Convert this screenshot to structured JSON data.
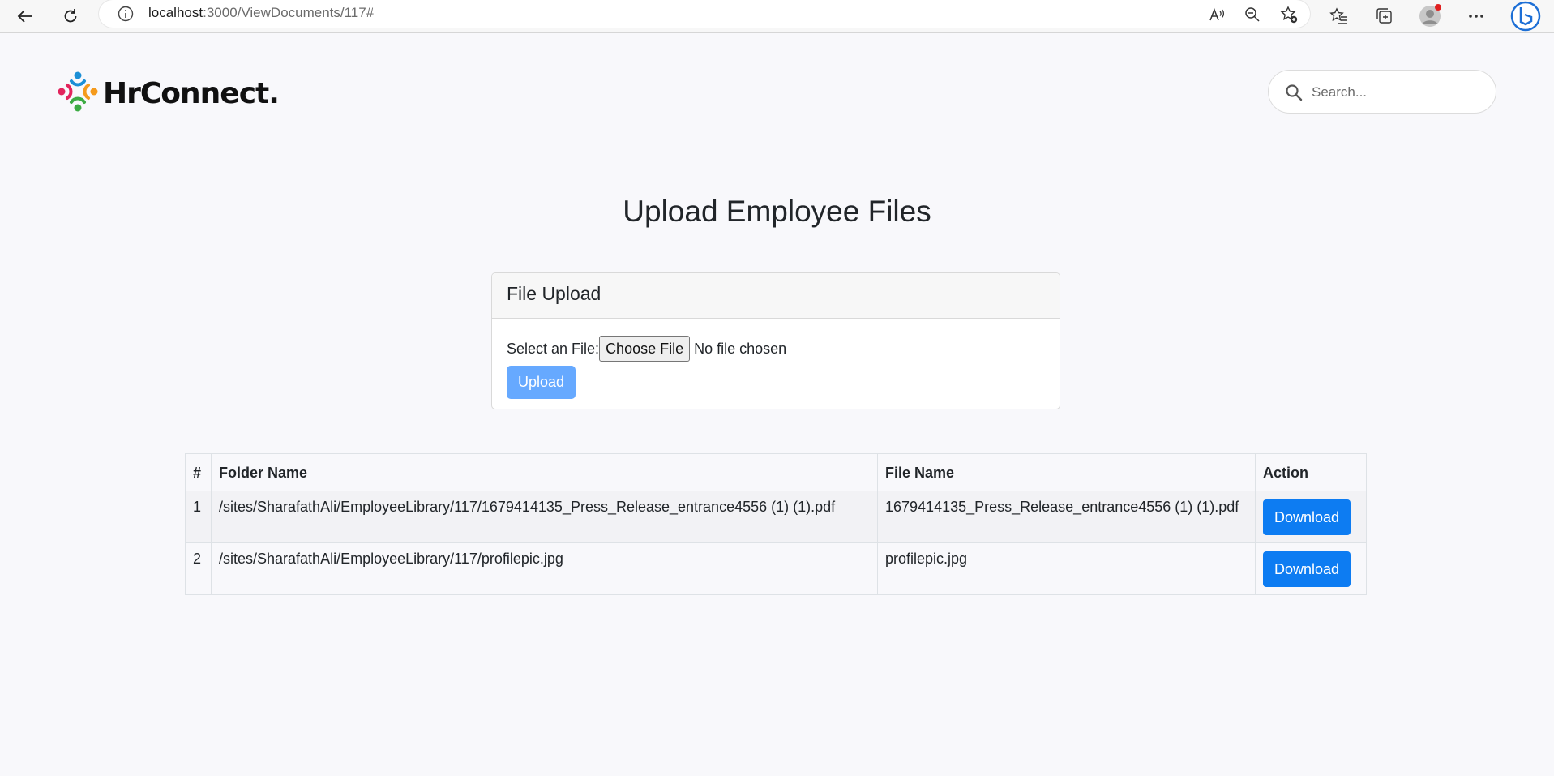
{
  "browser": {
    "url_host": "localhost",
    "url_rest": ":3000/ViewDocuments/117#",
    "icons": [
      "back-icon",
      "refresh-icon",
      "info-icon",
      "read-aloud-icon",
      "zoom-out-icon",
      "add-favorite-icon",
      "favorites-icon",
      "collections-icon",
      "profile-icon",
      "more-icon",
      "bing-icon"
    ]
  },
  "header": {
    "logo_text": "HrConnect.",
    "search_placeholder": "Search..."
  },
  "page_title": "Upload Employee Files",
  "upload_card": {
    "title": "File Upload",
    "select_label": "Select an File:",
    "choose_button": "Choose File",
    "no_file_text": "No file chosen",
    "upload_button": "Upload"
  },
  "table": {
    "headers": [
      "#",
      "Folder Name",
      "File Name",
      "Action"
    ],
    "rows": [
      {
        "num": "1",
        "folder": "/sites/SharafathAli/EmployeeLibrary/117/1679414135_Press_Release_entrance4556 (1) (1).pdf",
        "file": "1679414135_Press_Release_entrance4556 (1) (1).pdf",
        "action": "Download"
      },
      {
        "num": "2",
        "folder": "/sites/SharafathAli/EmployeeLibrary/117/profilepic.jpg",
        "file": "profilepic.jpg",
        "action": "Download"
      }
    ]
  },
  "colors": {
    "primary": "#0d7cf2",
    "upload_disabled": "#66a9ff",
    "page_bg": "#f8f8fb"
  }
}
